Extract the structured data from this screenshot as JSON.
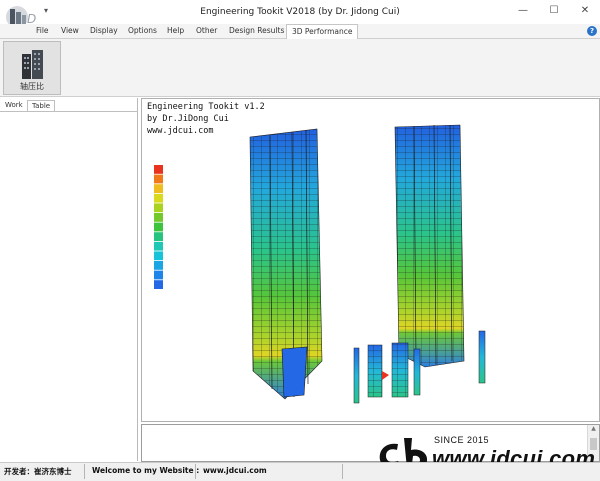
{
  "window": {
    "title": "Engineering Tookit V2018 (by Dr. Jidong Cui)",
    "minimize_glyph": "—",
    "maximize_glyph": "☐",
    "close_glyph": "✕",
    "quick_access_glyph": "▾"
  },
  "menu": {
    "items": [
      "File",
      "View",
      "Display",
      "Options",
      "Help",
      "Other",
      "Design Results",
      "3D Performance"
    ],
    "active": "3D Performance",
    "help_glyph": "?"
  },
  "ribbon": {
    "button_label": "轴压比",
    "button_icon": "building-icon"
  },
  "left_panel": {
    "tabs": [
      "Work",
      "Table"
    ],
    "active_tab": "Table"
  },
  "viewport": {
    "line1": "Engineering Tookit v1.2",
    "line2": "by Dr.JiDong Cui",
    "line3": "www.jdcui.com",
    "legend_colors": [
      "#e8331f",
      "#f07a1a",
      "#f0bd1e",
      "#d9d91e",
      "#a9d31f",
      "#74c829",
      "#3ec33c",
      "#27c47e",
      "#1fc8b4",
      "#17c3d8",
      "#1aa6e4",
      "#1d85ea",
      "#2468e6"
    ],
    "structure_colors": {
      "top": "#2260e0",
      "upper": "#23b8d8",
      "middle": "#37c24a",
      "lower": "#9fd22e",
      "base": "#e1d524",
      "marker": "#e8331f"
    }
  },
  "watermark": {
    "since": "SINCE 2015",
    "url": "www.jdcui.com"
  },
  "status": {
    "developer": "开发者：崔济东博士",
    "welcome": "Welcome to my Website :",
    "website": "www.jdcui.com"
  }
}
